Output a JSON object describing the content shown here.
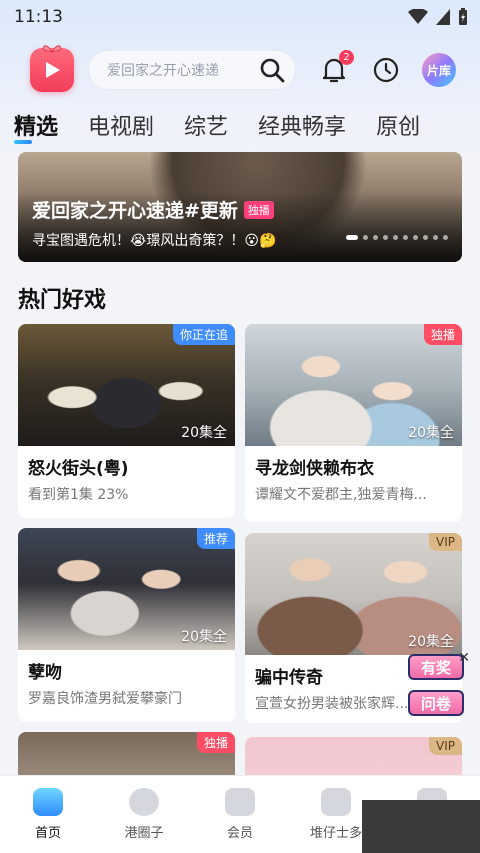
{
  "status": {
    "time": "11:13"
  },
  "header": {
    "search_placeholder": "爱回家之开心速递",
    "notification_count": "2",
    "library_label": "片库"
  },
  "tabs": [
    "精选",
    "电视剧",
    "综艺",
    "经典畅享",
    "原创"
  ],
  "banner": {
    "title": "爱回家之开心速递#更新",
    "tag": "独播",
    "subtitle": "寻宝图遇危机！😭璟风出奇策？！😮🤔"
  },
  "section": {
    "title": "热门好戏"
  },
  "cards": [
    {
      "title": "怒火街头(粤)",
      "sub": "看到第1集 23%",
      "episodes": "20集全",
      "corner": "你正在追",
      "progress": 0.23
    },
    {
      "title": "寻龙剑侠赖布衣",
      "sub": "谭耀文不爱郡主,独爱青梅...",
      "episodes": "20集全",
      "corner": "独播"
    },
    {
      "title": "孽吻",
      "sub": "罗嘉良饰渣男弑爱攀豪门",
      "episodes": "20集全",
      "corner": "推荐"
    },
    {
      "title": "骗中传奇",
      "sub": "宣萱女扮男装被张家辉...",
      "episodes": "20集全",
      "corner": "VIP"
    },
    {
      "title": "",
      "sub": "",
      "episodes": "",
      "corner": "独播"
    },
    {
      "title": "",
      "sub": "",
      "episodes": "",
      "corner": "VIP"
    }
  ],
  "float_ad": {
    "line1": "有奖",
    "line2": "问卷"
  },
  "bottom_nav": [
    "首页",
    "港圈子",
    "会员",
    "堆仔士多",
    ""
  ],
  "colors": {
    "accent_blue": "#2f86ff",
    "badge_red": "#ff3b5c",
    "tag_pink": "#ff3f7a",
    "vip_gold": "#dbb786"
  }
}
